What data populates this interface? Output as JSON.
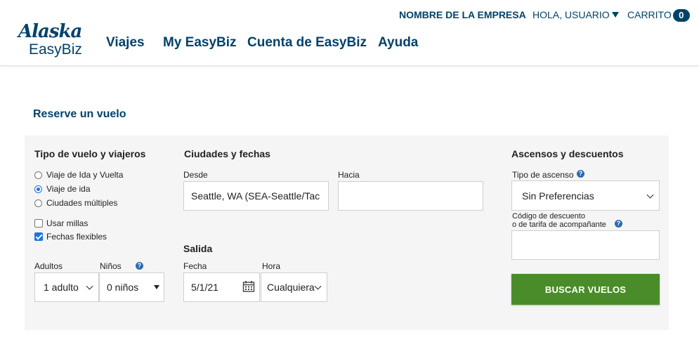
{
  "brand": {
    "name": "Alaska",
    "product": "EasyBiz"
  },
  "nav": {
    "items": [
      "Viajes",
      "My EasyBiz",
      "Cuenta de EasyBiz",
      "Ayuda"
    ]
  },
  "topbar": {
    "company": "NOMBRE DE LA EMPRESA",
    "user": "HOLA, USUARIO",
    "cart_label": "CARRITO",
    "cart_count": "0"
  },
  "page": {
    "title": "Reserve un vuelo"
  },
  "trip": {
    "title": "Tipo de vuelo y viajeros",
    "options": [
      "Viaje de Ida y Vuelta",
      "Viaje de ida",
      "Ciudades múltiples"
    ],
    "selected": "Viaje de ida",
    "checkboxes": [
      {
        "label": "Usar millas",
        "checked": false
      },
      {
        "label": "Fechas flexibles",
        "checked": true
      }
    ],
    "adults_label": "Adultos",
    "adults_value": "1 adulto",
    "children_label": "Niños",
    "children_value": "0 niños"
  },
  "cities": {
    "title": "Ciudades y fechas",
    "from_label": "Desde",
    "from_value": "Seattle, WA (SEA-Seattle/Tac",
    "to_label": "Hacia",
    "to_value": ""
  },
  "departure": {
    "title": "Salida",
    "date_label": "Fecha",
    "date_value": "5/1/21",
    "time_label": "Hora",
    "time_value": "Cualquiera"
  },
  "upgrades": {
    "title": "Ascensos y descuentos",
    "type_label": "Tipo de ascenso",
    "type_value": "Sin Preferencias",
    "code_label_1": "Código de descuento",
    "code_label_2": "o de tarifa de acompañante",
    "code_value": ""
  },
  "search_button": "BUSCAR VUELOS",
  "colors": {
    "brand_blue": "#01426a",
    "button_green": "#4a8c2a",
    "panel_gray": "#f5f5f5",
    "radio_blue": "#1a73e8"
  }
}
